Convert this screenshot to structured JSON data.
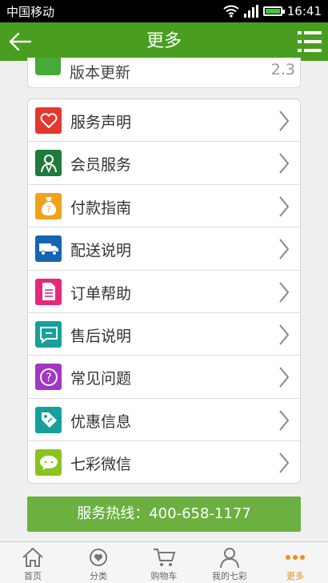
{
  "status_bar": {
    "carrier": "中国移动",
    "time": "16:41"
  },
  "header": {
    "title": "更多"
  },
  "version_row": {
    "label": "版本更新",
    "value": "2.3"
  },
  "menu_items": [
    {
      "label": "服务声明",
      "icon": "heart-icon",
      "color": "#e4382f"
    },
    {
      "label": "会员服务",
      "icon": "member-icon",
      "color": "#1f7a3c"
    },
    {
      "label": "付款指南",
      "icon": "money-bag-icon",
      "color": "#f0a21b"
    },
    {
      "label": "配送说明",
      "icon": "truck-icon",
      "color": "#1565b3"
    },
    {
      "label": "订单帮助",
      "icon": "document-icon",
      "color": "#e6287b"
    },
    {
      "label": "售后说明",
      "icon": "chat-icon",
      "color": "#16a09c"
    },
    {
      "label": "常见问题",
      "icon": "question-icon",
      "color": "#a336c4"
    },
    {
      "label": "优惠信息",
      "icon": "tag-icon",
      "color": "#16a09c"
    },
    {
      "label": "七彩微信",
      "icon": "wechat-icon",
      "color": "#8cc21f"
    }
  ],
  "hotline": {
    "label": "服务热线：400-658-1177"
  },
  "tabs": [
    {
      "label": "首页",
      "icon": "home-icon",
      "active": false
    },
    {
      "label": "分类",
      "icon": "category-icon",
      "active": false
    },
    {
      "label": "购物车",
      "icon": "cart-icon",
      "active": false
    },
    {
      "label": "我的七彩",
      "icon": "profile-icon",
      "active": false
    },
    {
      "label": "更多",
      "icon": "more-dots-icon",
      "active": true
    }
  ],
  "colors": {
    "brand_green": "#4a9e1f",
    "hotline_green": "#6bb040",
    "active_orange": "#f28c1d"
  }
}
